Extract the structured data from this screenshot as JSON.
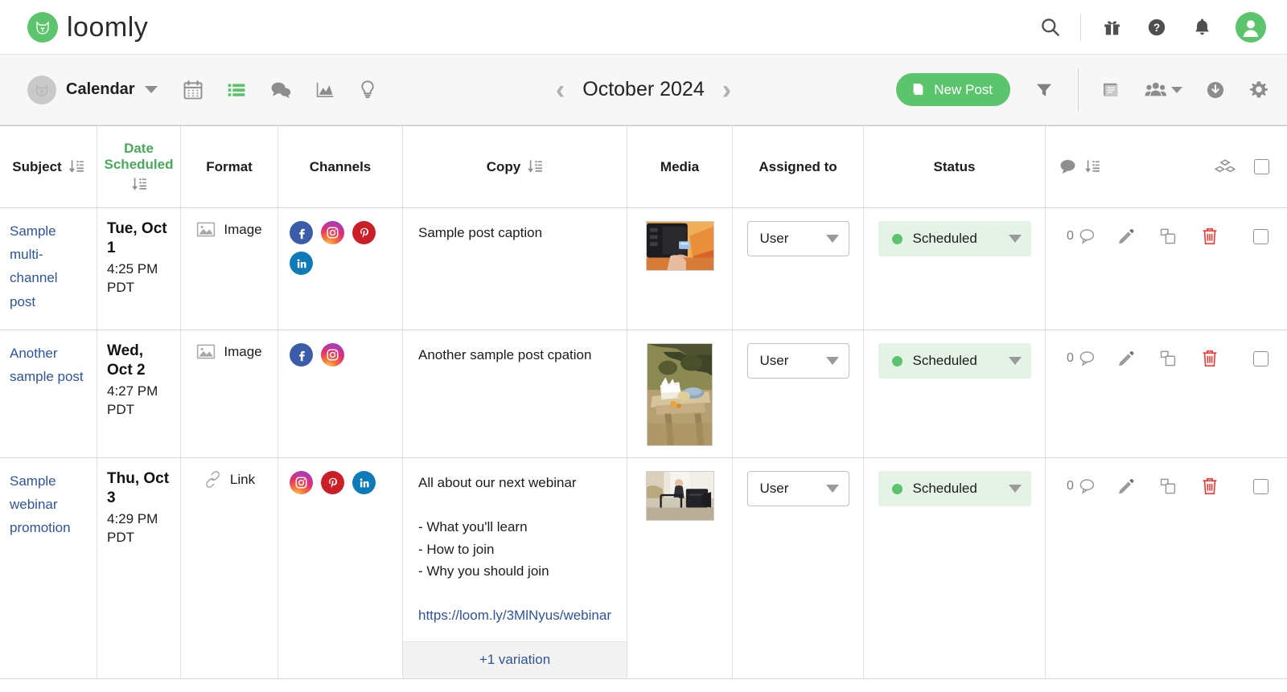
{
  "brand": {
    "name": "loomly",
    "mark_icon": "cat-logo-icon",
    "color": "#5cc46c"
  },
  "topbar": {
    "icons": [
      {
        "name": "search-icon",
        "label": "Search"
      },
      {
        "name": "gift-icon",
        "label": "Gift"
      },
      {
        "name": "help-icon",
        "label": "Help"
      },
      {
        "name": "bell-icon",
        "label": "Notifications"
      }
    ],
    "avatar": {
      "name": "user-avatar",
      "color": "#5cc46c"
    }
  },
  "toolbar": {
    "workspace": "Calendar",
    "view_icons": [
      {
        "name": "calendar-view-icon",
        "active": false
      },
      {
        "name": "list-view-icon",
        "active": true
      },
      {
        "name": "comments-view-icon",
        "active": false
      },
      {
        "name": "analytics-view-icon",
        "active": false
      },
      {
        "name": "ideas-view-icon",
        "active": false
      }
    ],
    "prev_label": "‹",
    "next_label": "›",
    "month": "October 2024",
    "new_post_label": "New Post",
    "filter_icon": "filter-icon",
    "right_icons": [
      {
        "name": "library-icon"
      },
      {
        "name": "audience-icon"
      },
      {
        "name": "download-icon"
      },
      {
        "name": "settings-gear-icon"
      }
    ]
  },
  "table": {
    "headers": {
      "subject": "Subject",
      "date_scheduled": "Date Scheduled",
      "format": "Format",
      "channels": "Channels",
      "copy": "Copy",
      "media": "Media",
      "assigned_to": "Assigned to",
      "status": "Status"
    },
    "active_sort_column": "Date Scheduled",
    "rows": [
      {
        "subject": "Sample multi-channel post",
        "date_day": "Tue, Oct 1",
        "date_time": "4:25 PM PDT",
        "format": "Image",
        "format_icon": "image-icon",
        "channels": [
          "facebook",
          "instagram",
          "pinterest",
          "linkedin"
        ],
        "copy": "Sample post caption",
        "copy_link": "",
        "variation": "",
        "media_icon": "camera-sdcard-photo",
        "media_shape": "wide",
        "assigned_to": "User",
        "status": "Scheduled",
        "comment_count": "0"
      },
      {
        "subject": "Another sample post",
        "date_day": "Wed, Oct 2",
        "date_time": "4:27 PM PDT",
        "format": "Image",
        "format_icon": "image-icon",
        "channels": [
          "facebook",
          "instagram"
        ],
        "copy": "Another sample post cpation",
        "copy_link": "",
        "variation": "",
        "media_icon": "picnic-table-photo",
        "media_shape": "tall",
        "assigned_to": "User",
        "status": "Scheduled",
        "comment_count": "0"
      },
      {
        "subject": "Sample webinar promotion",
        "date_day": "Thu, Oct 3",
        "date_time": "4:29 PM PDT",
        "format": "Link",
        "format_icon": "link-icon",
        "channels": [
          "instagram",
          "pinterest",
          "linkedin"
        ],
        "copy": "All about our next webinar\n\n- What you'll learn\n- How to join\n- Why you should join",
        "copy_link": "https://loom.ly/3MlNyus/webinar",
        "variation": "+1 variation",
        "media_icon": "webinar-setup-photo",
        "media_shape": "wide",
        "assigned_to": "User",
        "status": "Scheduled",
        "comment_count": "0"
      }
    ],
    "action_icons": [
      {
        "name": "comment-icon"
      },
      {
        "name": "edit-pencil-icon"
      },
      {
        "name": "duplicate-icon"
      },
      {
        "name": "delete-trash-icon"
      }
    ],
    "header_action_icons": [
      {
        "name": "comment-sort-icon"
      },
      {
        "name": "bulk-actions-icon"
      },
      {
        "name": "select-all-checkbox"
      }
    ]
  },
  "colors": {
    "accent_green": "#5cc46c",
    "status_bg": "#e4f3e5",
    "link_blue": "#2f5496",
    "trash_red": "#ef3b36"
  }
}
